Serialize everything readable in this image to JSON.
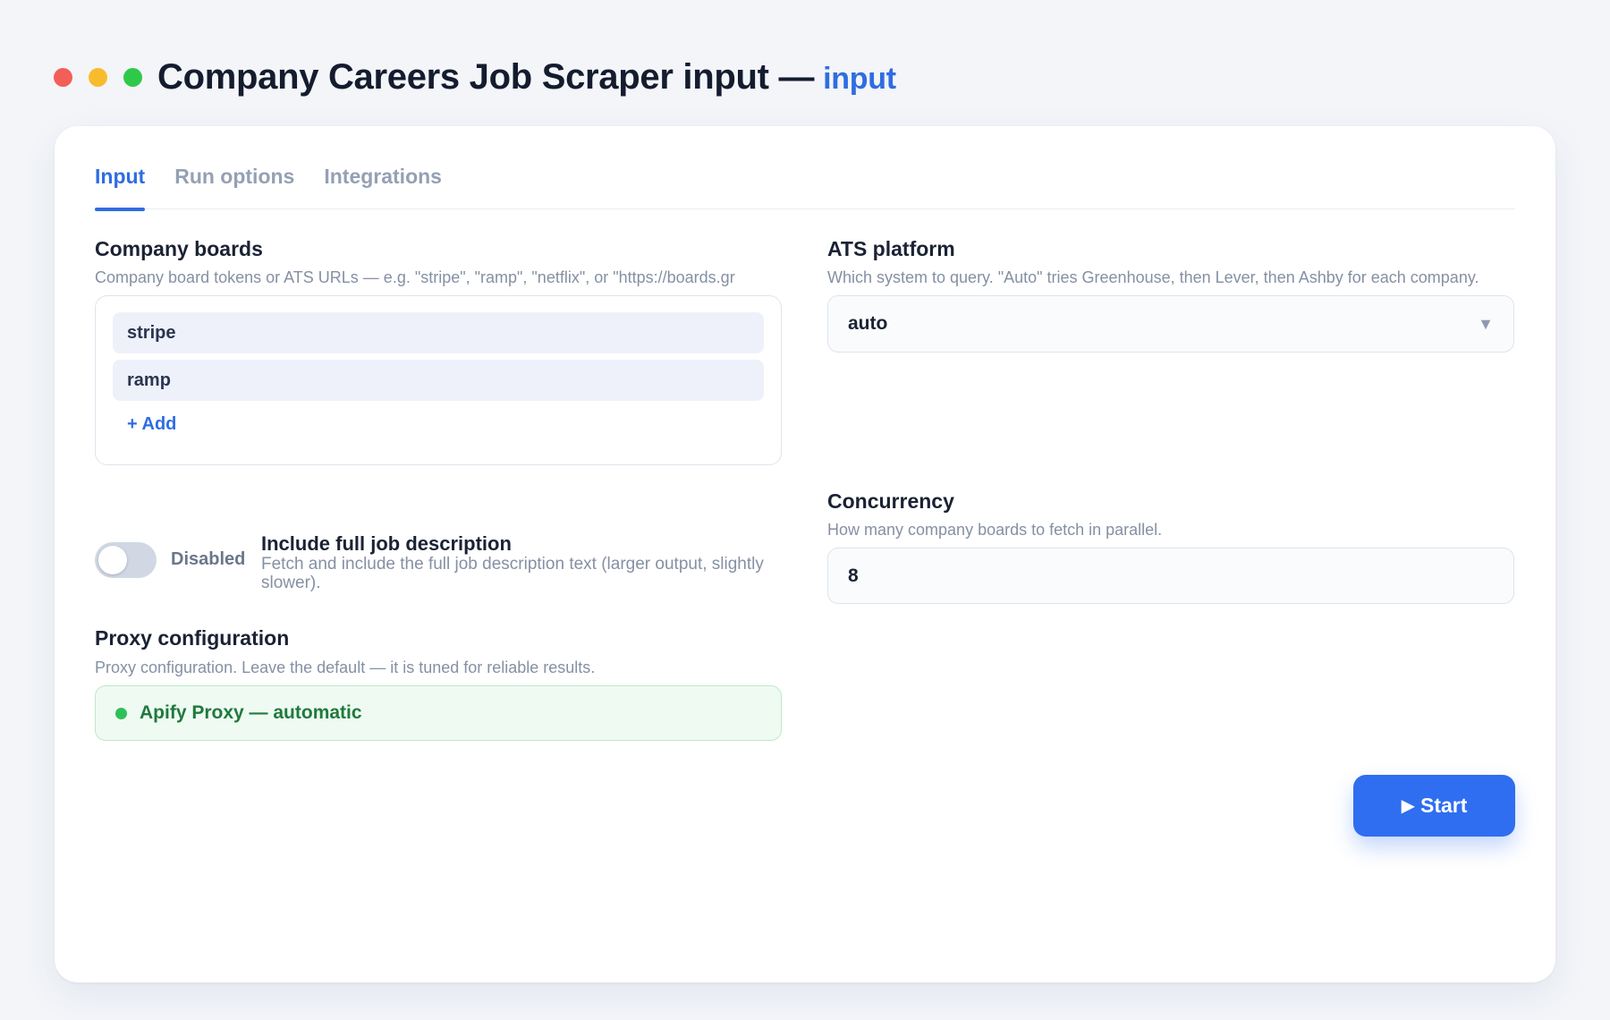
{
  "window": {
    "title": "Company Careers Job Scraper input —",
    "title_accent": "input"
  },
  "tabs": [
    {
      "label": "Input",
      "active": true
    },
    {
      "label": "Run options",
      "active": false
    },
    {
      "label": "Integrations",
      "active": false
    }
  ],
  "company_boards": {
    "label": "Company boards",
    "help": "Company board tokens or ATS URLs — e.g. \"stripe\", \"ramp\", \"netflix\", or \"https://boards.gr",
    "items": [
      "stripe",
      "ramp"
    ],
    "add_label": "+ Add"
  },
  "ats_platform": {
    "label": "ATS platform",
    "help": "Which system to query. \"Auto\" tries Greenhouse, then Lever, then Ashby for each company.",
    "value": "auto",
    "caret_icon": "▼"
  },
  "full_description": {
    "state_label": "Disabled",
    "enabled": false,
    "label": "Include full job description",
    "help": "Fetch and include the full job description text (larger output, slightly slower)."
  },
  "concurrency": {
    "label": "Concurrency",
    "help": "How many company boards to fetch in parallel.",
    "value": "8"
  },
  "proxy": {
    "label": "Proxy configuration",
    "help": "Proxy configuration. Leave the default — it is tuned for reliable results.",
    "value": "Apify Proxy — automatic",
    "status_color": "#2fbf5a"
  },
  "actions": {
    "start_icon": "▶",
    "start_label": "Start"
  },
  "colors": {
    "accent": "#2f6de1",
    "button": "#2f6ef0",
    "proxy_text": "#1f7a3c"
  }
}
